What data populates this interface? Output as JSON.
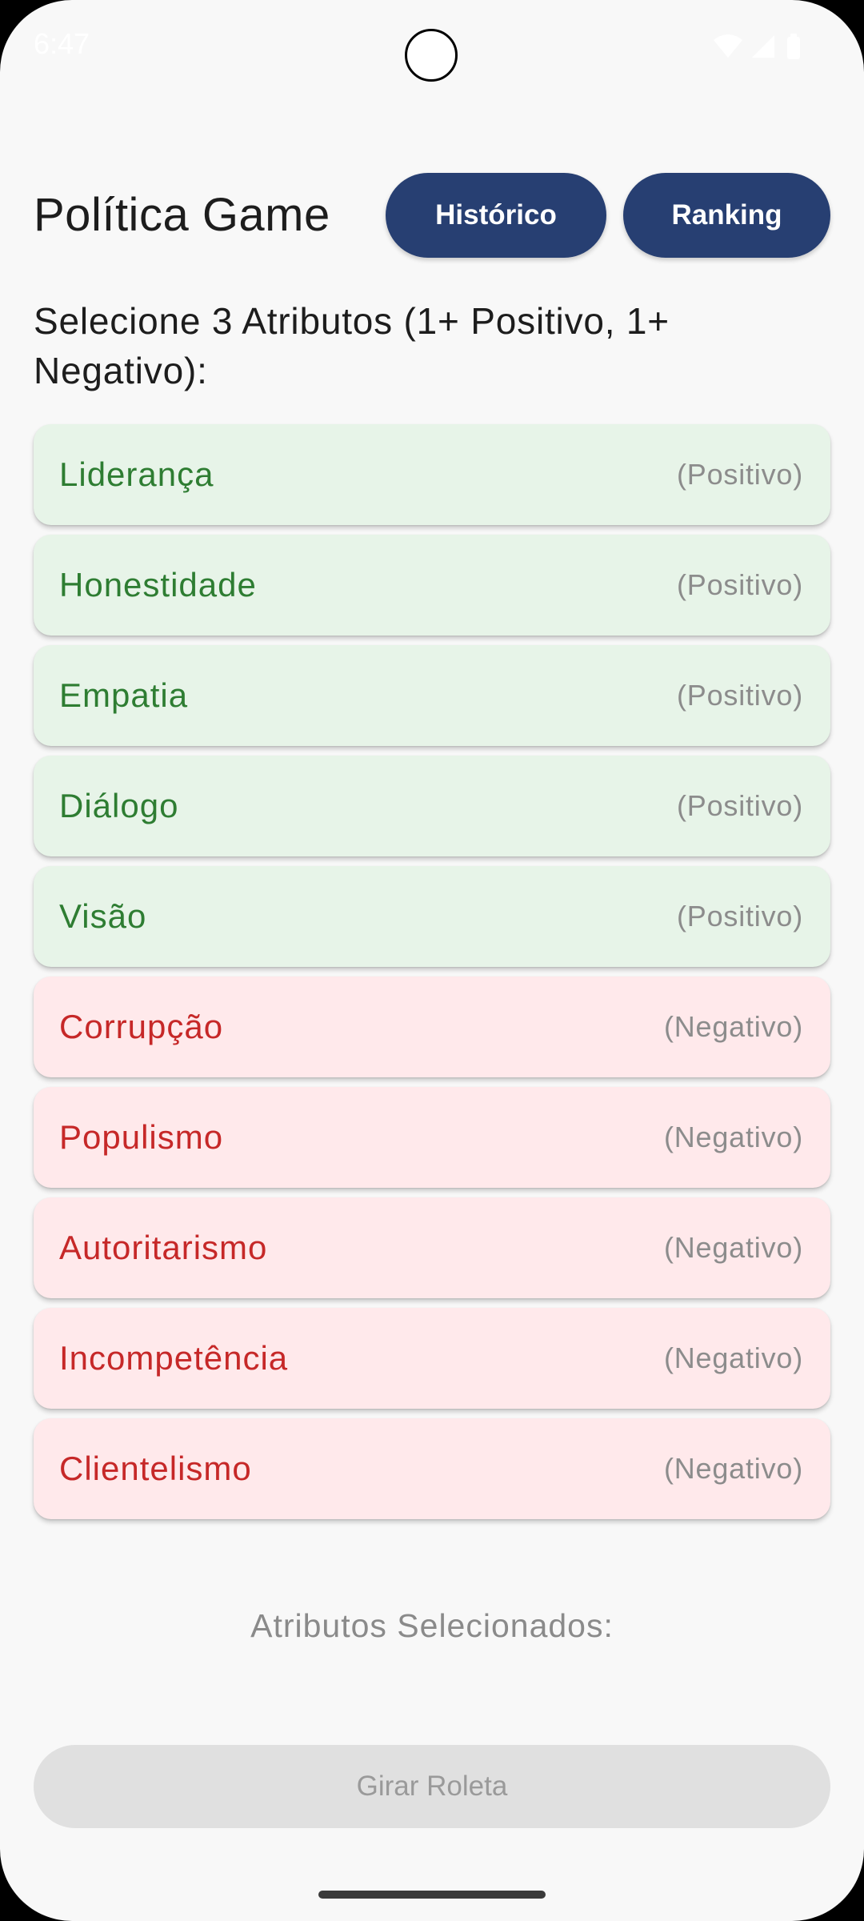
{
  "status_bar": {
    "time": "6:47"
  },
  "header": {
    "title": "Política Game",
    "historico_label": "Histórico",
    "ranking_label": "Ranking"
  },
  "instruction": "Selecione 3 Atributos (1+ Positivo, 1+ Negativo):",
  "attributes": [
    {
      "name": "Liderança",
      "type": "(Positivo)"
    },
    {
      "name": "Honestidade",
      "type": "(Positivo)"
    },
    {
      "name": "Empatia",
      "type": "(Positivo)"
    },
    {
      "name": "Diálogo",
      "type": "(Positivo)"
    },
    {
      "name": "Visão",
      "type": "(Positivo)"
    },
    {
      "name": "Corrupção",
      "type": "(Negativo)"
    },
    {
      "name": "Populismo",
      "type": "(Negativo)"
    },
    {
      "name": "Autoritarismo",
      "type": "(Negativo)"
    },
    {
      "name": "Incompetência",
      "type": "(Negativo)"
    },
    {
      "name": "Clientelismo",
      "type": "(Negativo)"
    }
  ],
  "selected_label": "Atributos Selecionados:",
  "spin_button_label": "Girar Roleta",
  "colors": {
    "primary_button": "#273f72",
    "positive_bg": "#e7f4e8",
    "positive_text": "#2e7d32",
    "negative_bg": "#ffe9eb",
    "negative_text": "#c62828",
    "disabled_button": "#e0e0e0"
  },
  "icons": [
    "wifi-icon",
    "signal-icon",
    "battery-icon"
  ]
}
